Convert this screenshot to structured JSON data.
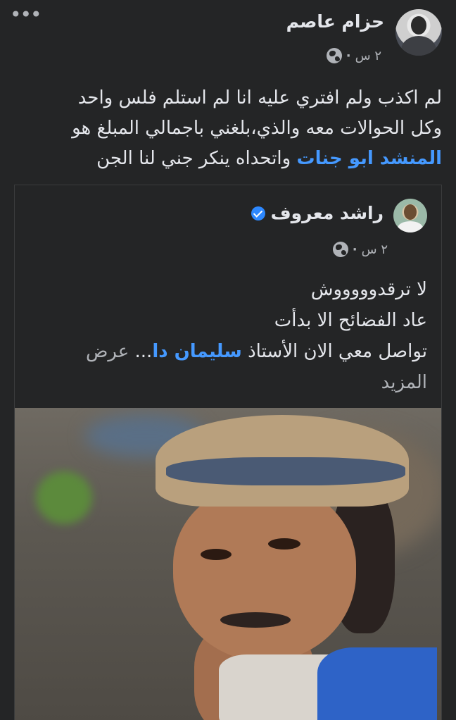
{
  "post": {
    "author": "حزام عاصم",
    "time": "٢ س",
    "separator": "·",
    "privacy_icon": "globe-icon",
    "more_label": "•••",
    "text_line1": "لم اكذب ولم افتري عليه انا لم استلم فلس واحد",
    "text_line2": "وكل الحوالات معه والذي،بلغني باجمالي المبلغ هو",
    "mention": "المنشد ابو جنات",
    "text_line3_rest": " واتحداه ينكر جني لنا الجن"
  },
  "shared_post": {
    "author": "راشد معروف",
    "verified_icon": "verified-badge-icon",
    "time": "٢ س",
    "separator": "·",
    "privacy_icon": "globe-icon",
    "line1": "لا ترقدوووووش",
    "line2": "عاد الفضائح الا بدأت",
    "line3_pre": "تواصل معي الان الأستاذ ",
    "mention": "سليمان دا",
    "ellipsis": "...",
    "see_more_word1": " عرض",
    "see_more_word2": "المزيد",
    "photo_description_icon": "portrait-photo"
  },
  "colors": {
    "background": "#242526",
    "text": "#e4e6eb",
    "secondary_text": "#b0b3b8",
    "link": "#4599ff",
    "verified": "#2d88ff"
  }
}
